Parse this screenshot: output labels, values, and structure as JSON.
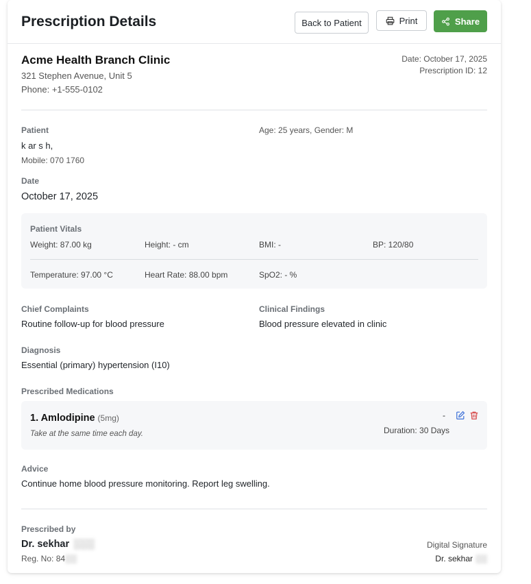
{
  "header": {
    "title": "Prescription Details",
    "back_label": "Back to Patient",
    "print_label": "Print",
    "share_label": "Share"
  },
  "clinic": {
    "name": "Acme Health Branch Clinic",
    "address": "321 Stephen Avenue, Unit 5",
    "phone": "Phone: +1-555-0102",
    "date": "Date: October 17, 2025",
    "prescription_id": "Prescription ID: 12"
  },
  "patient": {
    "label": "Patient",
    "name": "k    ar s   h,",
    "mobile": "Mobile: 070      1760",
    "age_gender": "Age: 25 years, Gender: M"
  },
  "date": {
    "label": "Date",
    "value": "October 17, 2025"
  },
  "vitals": {
    "title": "Patient Vitals",
    "weight": "Weight: 87.00 kg",
    "height": "Height: - cm",
    "bmi": "BMI: -",
    "bp": "BP: 120/80",
    "temperature": "Temperature: 97.00 °C",
    "heart_rate": "Heart Rate: 88.00 bpm",
    "spo2": "SpO2: - %"
  },
  "clinical": {
    "complaints_label": "Chief Complaints",
    "complaints": "Routine follow-up for blood pressure",
    "findings_label": "Clinical Findings",
    "findings": "Blood pressure elevated in clinic",
    "diagnosis_label": "Diagnosis",
    "diagnosis": "Essential (primary) hypertension (I10)"
  },
  "medications": {
    "label": "Prescribed Medications",
    "items": [
      {
        "name": "1. Amlodipine",
        "dose": "(5mg)",
        "instructions": "Take at the same time each day.",
        "frequency": "-",
        "duration": "Duration: 30 Days"
      }
    ]
  },
  "advice": {
    "label": "Advice",
    "text": "Continue home blood pressure monitoring. Report leg swelling."
  },
  "prescriber": {
    "label": "Prescribed by",
    "name": "Dr. sekhar",
    "reg": "Reg. No: 84",
    "signature_label": "Digital Signature",
    "signature_name": "Dr. sekhar"
  },
  "colors": {
    "share_button": "#4f9f4a",
    "edit_icon": "#3a6fd8",
    "delete_icon": "#d64545"
  }
}
